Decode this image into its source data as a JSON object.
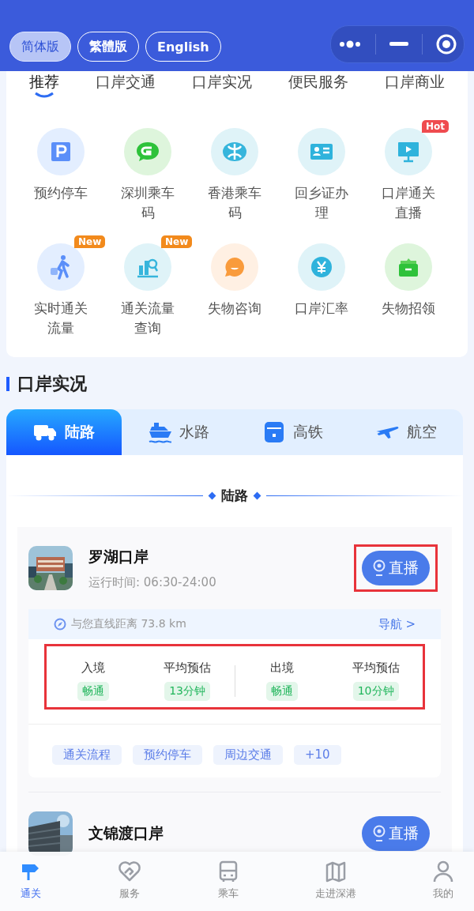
{
  "language_buttons": [
    {
      "label": "简体版",
      "selected": true
    },
    {
      "label": "繁體版",
      "selected": false
    },
    {
      "label": "English",
      "selected": false
    }
  ],
  "category_tabs": [
    {
      "label": "推荐",
      "selected": true
    },
    {
      "label": "口岸交通",
      "selected": false
    },
    {
      "label": "口岸实况",
      "selected": false
    },
    {
      "label": "便民服务",
      "selected": false
    },
    {
      "label": "口岸商业",
      "selected": false
    }
  ],
  "services": [
    {
      "label": "预约停车",
      "kind": "parking"
    },
    {
      "label": "深圳乘车码",
      "kind": "chat"
    },
    {
      "label": "香港乘车码",
      "kind": "metro"
    },
    {
      "label": "回乡证办理",
      "kind": "idcard"
    },
    {
      "label": "口岸通关直播",
      "kind": "screen",
      "badge": {
        "text": "Hot",
        "color": "#ef4b4f"
      }
    },
    {
      "label": "实时通关流量",
      "kind": "walker",
      "badge": {
        "text": "New",
        "color": "#f28a1c"
      }
    },
    {
      "label": "通关流量查询",
      "kind": "chart",
      "badge": {
        "text": "New",
        "color": "#f28a1c"
      }
    },
    {
      "label": "失物咨询",
      "kind": "bubble"
    },
    {
      "label": "口岸汇率",
      "kind": "yen"
    },
    {
      "label": "失物招领",
      "kind": "box"
    }
  ],
  "section_title": "口岸实况",
  "transport_tabs": [
    {
      "label": "陆路",
      "kind": "truck",
      "selected": true
    },
    {
      "label": "水路",
      "kind": "ship",
      "selected": false
    },
    {
      "label": "高铁",
      "kind": "train",
      "selected": false
    },
    {
      "label": "航空",
      "kind": "plane",
      "selected": false
    }
  ],
  "divider_label": "陆路",
  "ports": [
    {
      "name": "罗湖口岸",
      "hours": "运行时间: 06:30-24:00",
      "live_label": "直播",
      "live_highlighted": true,
      "distance": "与您直线距离 73.8 km",
      "nav_link": "导航 >",
      "stats_highlighted": true,
      "stats": [
        {
          "label": "入境",
          "value": "畅通"
        },
        {
          "label": "平均预估",
          "value": "13分钟"
        },
        {
          "label": "出境",
          "value": "畅通"
        },
        {
          "label": "平均预估",
          "value": "10分钟"
        }
      ],
      "tags": [
        "通关流程",
        "预约停车",
        "周边交通",
        "+10"
      ]
    },
    {
      "name": "文锦渡口岸",
      "live_label": "直播",
      "live_highlighted": false
    }
  ],
  "bottom_nav": [
    {
      "label": "通关",
      "kind": "signpost",
      "selected": true
    },
    {
      "label": "服务",
      "kind": "heart",
      "selected": false
    },
    {
      "label": "乘车",
      "kind": "bus",
      "selected": false
    },
    {
      "label": "走进深港",
      "kind": "map",
      "selected": false
    },
    {
      "label": "我的",
      "kind": "person",
      "selected": false
    }
  ]
}
